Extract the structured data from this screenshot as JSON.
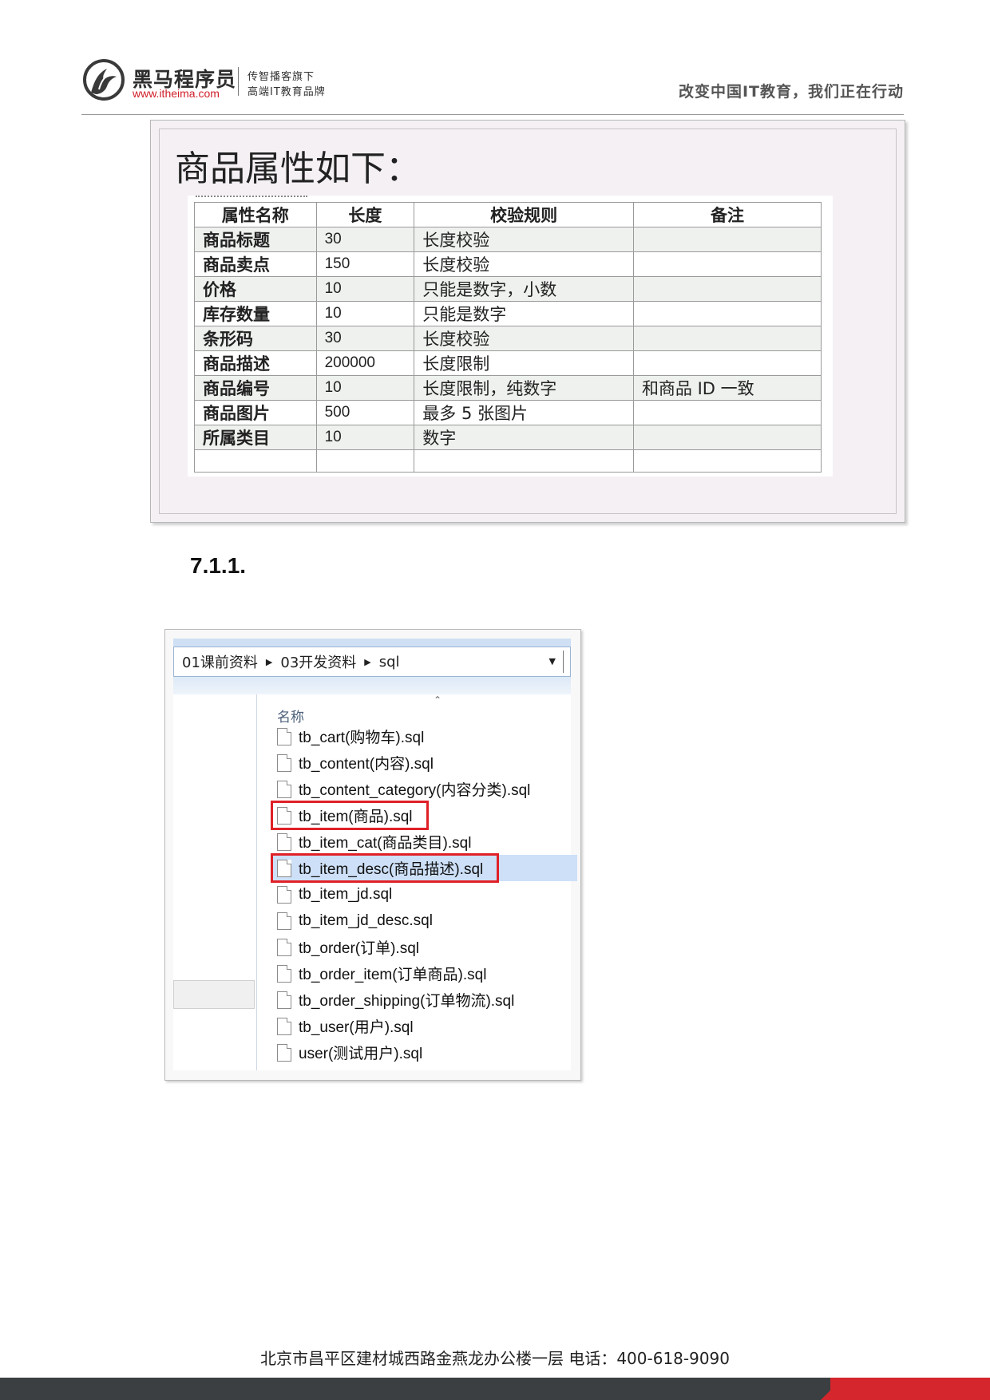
{
  "header": {
    "brand": "黑马程序员",
    "url": "www.itheima.com",
    "tagline1": "传智播客旗下",
    "tagline2": "高端IT教育品牌",
    "slogan": "改变中国IT教育，我们正在行动"
  },
  "attributes": {
    "title": "商品属性如下：",
    "columns": [
      "属性名称",
      "长度",
      "校验规则",
      "备注"
    ],
    "rows": [
      [
        "商品标题",
        "30",
        "长度校验",
        ""
      ],
      [
        "商品卖点",
        "150",
        "长度校验",
        ""
      ],
      [
        "价格",
        "10",
        "只能是数字，小数",
        ""
      ],
      [
        "库存数量",
        "10",
        "只能是数字",
        ""
      ],
      [
        "条形码",
        "30",
        "长度校验",
        ""
      ],
      [
        "商品描述",
        "200000",
        "长度限制",
        ""
      ],
      [
        "商品编号",
        "10",
        "长度限制，纯数字",
        "和商品 ID 一致"
      ],
      [
        "商品图片",
        "500",
        "最多 5 张图片",
        ""
      ],
      [
        "所属类目",
        "10",
        "数字",
        ""
      ]
    ]
  },
  "section": {
    "number": "7.1.1."
  },
  "explorer": {
    "breadcrumb": [
      "01课前资料",
      "03开发资料",
      "sql"
    ],
    "column_header": "名称",
    "files": [
      "tb_cart(购物车).sql",
      "tb_content(内容).sql",
      "tb_content_category(内容分类).sql",
      "tb_item(商品).sql",
      "tb_item_cat(商品类目).sql",
      "tb_item_desc(商品描述).sql",
      "tb_item_jd.sql",
      "tb_item_jd_desc.sql",
      "tb_order(订单).sql",
      "tb_order_item(订单商品).sql",
      "tb_order_shipping(订单物流).sql",
      "tb_user(用户).sql",
      "user(测试用户).sql"
    ],
    "selected_file": "tb_item_desc(商品描述).sql",
    "highlighted_files": [
      "tb_item(商品).sql",
      "tb_item_desc(商品描述).sql"
    ],
    "highlight_color": "#e02027"
  },
  "footer": {
    "address": "北京市昌平区建材城西路金燕龙办公楼一层   电话：400-618-9090",
    "bar_color": "#3b3f41",
    "accent_color": "#d4262c"
  }
}
